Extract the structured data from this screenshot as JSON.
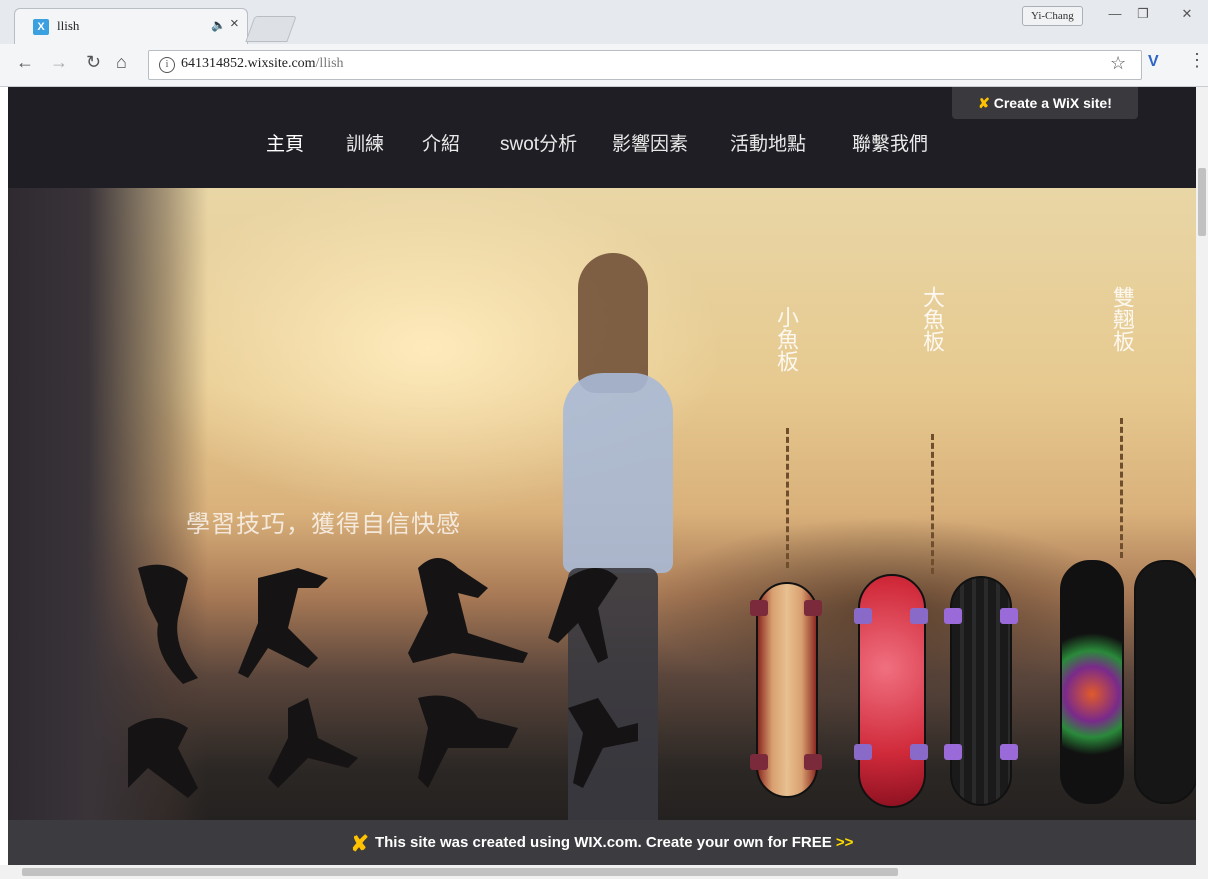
{
  "browser": {
    "tab": {
      "title": "llish",
      "favicon": "wix-favicon-icon",
      "audio": "🔈",
      "close": "×"
    },
    "profile_name": "Yi-Chang",
    "window_controls": {
      "minimize": "—",
      "maximize": "❐",
      "close": "✕"
    },
    "nav": {
      "back": "←",
      "forward": "→",
      "reload": "↻",
      "home": "⌂"
    },
    "url_host": "641314852.wixsite.com",
    "url_path": "/llish",
    "info": "i",
    "star": "☆",
    "extension": "V",
    "menu": "⋮"
  },
  "site": {
    "wix_badge": "Create a WiX site!",
    "nav": [
      "主頁",
      "訓練",
      "介紹",
      "swot分析",
      "影響因素",
      "活動地點",
      "聯繫我們"
    ],
    "slogan": "學習技巧，獲得自信快感",
    "board_labels": [
      "小魚板",
      "大魚板",
      "雙翹板"
    ],
    "banner_text": "This site was created using WIX.com. Create your own for FREE",
    "banner_free": ">>"
  },
  "colors": {
    "nav_bg": "#1f1e24",
    "banner_bg": "#3c3b3f",
    "banner_accent": "#ffdd00",
    "wix_logo": "#ffc200"
  }
}
